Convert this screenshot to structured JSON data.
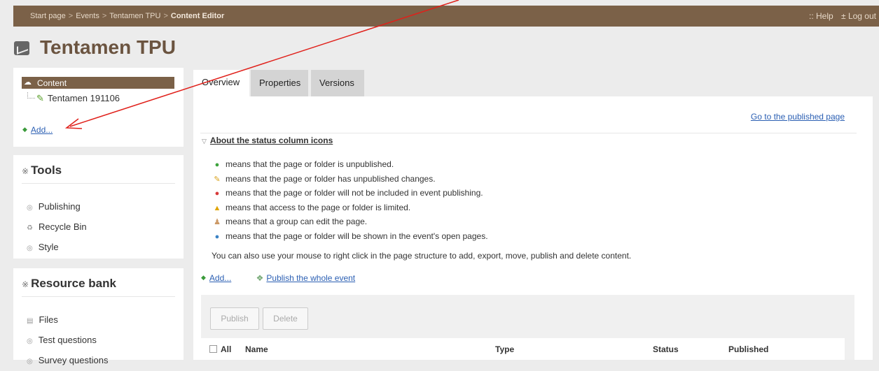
{
  "breadcrumb": [
    "Start page",
    "Events",
    "Tentamen TPU",
    "Content Editor"
  ],
  "top_links": {
    "help": ":: Help",
    "logout": "± Log out"
  },
  "page_title": "Tentamen TPU",
  "content_tree": {
    "root": "Content",
    "child": "Tentamen 191106",
    "add": "Add..."
  },
  "tools": {
    "title": "Tools",
    "items": [
      "Publishing",
      "Recycle Bin",
      "Style"
    ]
  },
  "resource_bank": {
    "title": "Resource bank",
    "items": [
      "Files",
      "Test questions",
      "Survey questions"
    ]
  },
  "tabs": [
    "Overview",
    "Properties",
    "Versions"
  ],
  "main": {
    "published_link": "Go to the published page",
    "about_title": "About the status column icons",
    "legend": [
      {
        "icon": "plus-circle-icon",
        "text": "means that the page or folder is unpublished."
      },
      {
        "icon": "pencil-icon",
        "text": "means that the page or folder has unpublished changes."
      },
      {
        "icon": "minus-circle-icon",
        "text": "means that the page or folder will not be included in event publishing."
      },
      {
        "icon": "warning-icon",
        "text": "means that access to the page or folder is limited."
      },
      {
        "icon": "group-icon",
        "text": "means that a group can edit the page."
      },
      {
        "icon": "globe-icon",
        "text": "means that the page or folder will be shown in the event's open pages."
      }
    ],
    "right_click_text": "You can also use your mouse to right click in the page structure to add, export, move, publish and delete content.",
    "add_link": "Add...",
    "publish_event": "Publish the whole event",
    "buttons": {
      "publish": "Publish",
      "delete": "Delete"
    },
    "columns": {
      "all": "All",
      "name": "Name",
      "type": "Type",
      "status": "Status",
      "published": "Published"
    }
  },
  "colors": {
    "brown": "#7b6148",
    "link": "#2b5fb3",
    "arrow": "#e0201a"
  }
}
